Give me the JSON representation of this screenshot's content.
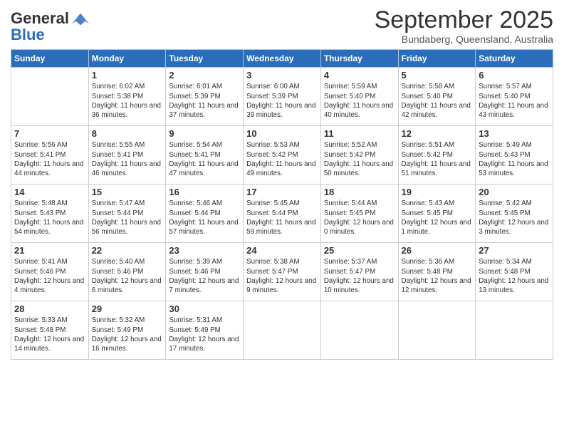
{
  "logo": {
    "text_general": "General",
    "text_blue": "Blue"
  },
  "title": "September 2025",
  "location": "Bundaberg, Queensland, Australia",
  "weekdays": [
    "Sunday",
    "Monday",
    "Tuesday",
    "Wednesday",
    "Thursday",
    "Friday",
    "Saturday"
  ],
  "days": [
    {
      "number": "",
      "sunrise": "",
      "sunset": "",
      "daylight": ""
    },
    {
      "number": "1",
      "sunrise": "Sunrise: 6:02 AM",
      "sunset": "Sunset: 5:38 PM",
      "daylight": "Daylight: 11 hours and 36 minutes."
    },
    {
      "number": "2",
      "sunrise": "Sunrise: 6:01 AM",
      "sunset": "Sunset: 5:39 PM",
      "daylight": "Daylight: 11 hours and 37 minutes."
    },
    {
      "number": "3",
      "sunrise": "Sunrise: 6:00 AM",
      "sunset": "Sunset: 5:39 PM",
      "daylight": "Daylight: 11 hours and 39 minutes."
    },
    {
      "number": "4",
      "sunrise": "Sunrise: 5:59 AM",
      "sunset": "Sunset: 5:40 PM",
      "daylight": "Daylight: 11 hours and 40 minutes."
    },
    {
      "number": "5",
      "sunrise": "Sunrise: 5:58 AM",
      "sunset": "Sunset: 5:40 PM",
      "daylight": "Daylight: 11 hours and 42 minutes."
    },
    {
      "number": "6",
      "sunrise": "Sunrise: 5:57 AM",
      "sunset": "Sunset: 5:40 PM",
      "daylight": "Daylight: 11 hours and 43 minutes."
    },
    {
      "number": "7",
      "sunrise": "Sunrise: 5:56 AM",
      "sunset": "Sunset: 5:41 PM",
      "daylight": "Daylight: 11 hours and 44 minutes."
    },
    {
      "number": "8",
      "sunrise": "Sunrise: 5:55 AM",
      "sunset": "Sunset: 5:41 PM",
      "daylight": "Daylight: 11 hours and 46 minutes."
    },
    {
      "number": "9",
      "sunrise": "Sunrise: 5:54 AM",
      "sunset": "Sunset: 5:41 PM",
      "daylight": "Daylight: 11 hours and 47 minutes."
    },
    {
      "number": "10",
      "sunrise": "Sunrise: 5:53 AM",
      "sunset": "Sunset: 5:42 PM",
      "daylight": "Daylight: 11 hours and 49 minutes."
    },
    {
      "number": "11",
      "sunrise": "Sunrise: 5:52 AM",
      "sunset": "Sunset: 5:42 PM",
      "daylight": "Daylight: 11 hours and 50 minutes."
    },
    {
      "number": "12",
      "sunrise": "Sunrise: 5:51 AM",
      "sunset": "Sunset: 5:42 PM",
      "daylight": "Daylight: 11 hours and 51 minutes."
    },
    {
      "number": "13",
      "sunrise": "Sunrise: 5:49 AM",
      "sunset": "Sunset: 5:43 PM",
      "daylight": "Daylight: 11 hours and 53 minutes."
    },
    {
      "number": "14",
      "sunrise": "Sunrise: 5:48 AM",
      "sunset": "Sunset: 5:43 PM",
      "daylight": "Daylight: 11 hours and 54 minutes."
    },
    {
      "number": "15",
      "sunrise": "Sunrise: 5:47 AM",
      "sunset": "Sunset: 5:44 PM",
      "daylight": "Daylight: 11 hours and 56 minutes."
    },
    {
      "number": "16",
      "sunrise": "Sunrise: 5:46 AM",
      "sunset": "Sunset: 5:44 PM",
      "daylight": "Daylight: 11 hours and 57 minutes."
    },
    {
      "number": "17",
      "sunrise": "Sunrise: 5:45 AM",
      "sunset": "Sunset: 5:44 PM",
      "daylight": "Daylight: 11 hours and 59 minutes."
    },
    {
      "number": "18",
      "sunrise": "Sunrise: 5:44 AM",
      "sunset": "Sunset: 5:45 PM",
      "daylight": "Daylight: 12 hours and 0 minutes."
    },
    {
      "number": "19",
      "sunrise": "Sunrise: 5:43 AM",
      "sunset": "Sunset: 5:45 PM",
      "daylight": "Daylight: 12 hours and 1 minute."
    },
    {
      "number": "20",
      "sunrise": "Sunrise: 5:42 AM",
      "sunset": "Sunset: 5:45 PM",
      "daylight": "Daylight: 12 hours and 3 minutes."
    },
    {
      "number": "21",
      "sunrise": "Sunrise: 5:41 AM",
      "sunset": "Sunset: 5:46 PM",
      "daylight": "Daylight: 12 hours and 4 minutes."
    },
    {
      "number": "22",
      "sunrise": "Sunrise: 5:40 AM",
      "sunset": "Sunset: 5:46 PM",
      "daylight": "Daylight: 12 hours and 6 minutes."
    },
    {
      "number": "23",
      "sunrise": "Sunrise: 5:39 AM",
      "sunset": "Sunset: 5:46 PM",
      "daylight": "Daylight: 12 hours and 7 minutes."
    },
    {
      "number": "24",
      "sunrise": "Sunrise: 5:38 AM",
      "sunset": "Sunset: 5:47 PM",
      "daylight": "Daylight: 12 hours and 9 minutes."
    },
    {
      "number": "25",
      "sunrise": "Sunrise: 5:37 AM",
      "sunset": "Sunset: 5:47 PM",
      "daylight": "Daylight: 12 hours and 10 minutes."
    },
    {
      "number": "26",
      "sunrise": "Sunrise: 5:36 AM",
      "sunset": "Sunset: 5:48 PM",
      "daylight": "Daylight: 12 hours and 12 minutes."
    },
    {
      "number": "27",
      "sunrise": "Sunrise: 5:34 AM",
      "sunset": "Sunset: 5:48 PM",
      "daylight": "Daylight: 12 hours and 13 minutes."
    },
    {
      "number": "28",
      "sunrise": "Sunrise: 5:33 AM",
      "sunset": "Sunset: 5:48 PM",
      "daylight": "Daylight: 12 hours and 14 minutes."
    },
    {
      "number": "29",
      "sunrise": "Sunrise: 5:32 AM",
      "sunset": "Sunset: 5:49 PM",
      "daylight": "Daylight: 12 hours and 16 minutes."
    },
    {
      "number": "30",
      "sunrise": "Sunrise: 5:31 AM",
      "sunset": "Sunset: 5:49 PM",
      "daylight": "Daylight: 12 hours and 17 minutes."
    }
  ]
}
